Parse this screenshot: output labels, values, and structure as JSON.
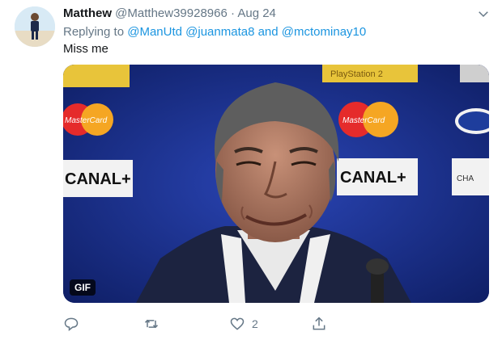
{
  "tweet": {
    "name": "Matthew",
    "handle": "@Matthew39928966",
    "separator": "·",
    "time": "Aug 24",
    "replying_prefix": "Replying to",
    "mentions": [
      "@ManUtd",
      "@juanmata8"
    ],
    "and": "and",
    "last_mention": "@mctominay10",
    "text": "Miss me",
    "media": {
      "badge": "GIF",
      "banner_top_left": "",
      "banner_top_center": "PlayStation 2",
      "mastercard": "MasterCard",
      "canal": "CANAL+",
      "right_text": "CHA"
    },
    "actions": {
      "likes": "2"
    },
    "colors": {
      "link": "#1b95e0",
      "muted": "#657786",
      "backdrop": "#1a2f86"
    },
    "icons": [
      "chevron-down-icon",
      "reply-icon",
      "retweet-icon",
      "like-icon",
      "share-icon"
    ]
  }
}
